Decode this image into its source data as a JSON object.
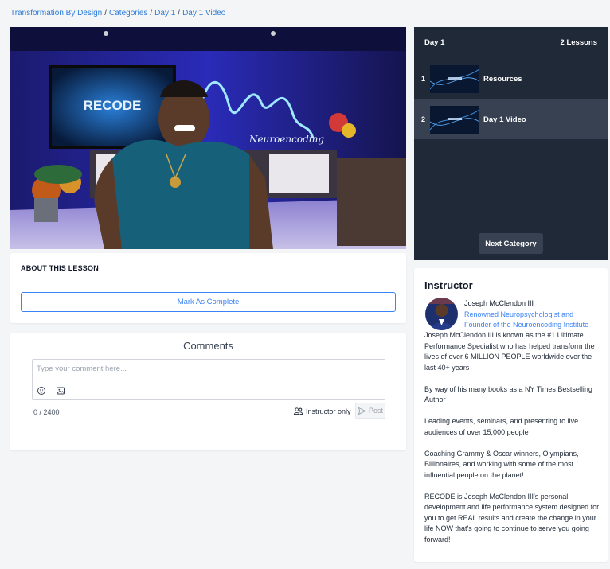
{
  "breadcrumb": {
    "items": [
      "Transformation By Design",
      "Categories",
      "Day 1",
      "Day 1 Video"
    ],
    "separator": "/"
  },
  "video": {
    "screen_text": "RECODE",
    "wall_text": "Neuroencoding"
  },
  "about": {
    "title": "ABOUT THIS LESSON",
    "mark_complete_label": "Mark As Complete"
  },
  "comments": {
    "title": "Comments",
    "placeholder": "Type your comment here...",
    "counter": "0 / 2400",
    "instructor_only_label": "Instructor only",
    "post_label": "Post",
    "icons": [
      "smiley-icon",
      "image-icon",
      "users-icon",
      "send-icon"
    ]
  },
  "playlist": {
    "category_title": "Day 1",
    "lesson_count": "2 Lessons",
    "items": [
      {
        "number": "1",
        "title": "Resources",
        "active": false
      },
      {
        "number": "2",
        "title": "Day 1 Video",
        "active": true
      }
    ],
    "next_category_label": "Next Category"
  },
  "instructor": {
    "heading": "Instructor",
    "name": "Joseph McClendon III",
    "role": "Renowned Neuropsychologist and Founder of the Neuroencoding Institute",
    "bio": [
      "Joseph McClendon III is known as the #1 Ultimate Performance Specialist who has helped transform the lives of over 6 MILLION PEOPLE worldwide over the last 40+ years",
      "By way of his many books as a NY Times Bestselling Author",
      "Leading events, seminars, and presenting to live audiences of over 15,000 people",
      "Coaching Grammy & Oscar winners, Olympians, Billionaires, and working with some of the most influential people on the planet!",
      "RECODE is Joseph McClendon III's personal development and life performance system designed for you to get REAL results and create the change in your life NOW that's going to continue to serve you going forward!"
    ]
  },
  "colors": {
    "link": "#2b7bd6",
    "accent": "#3b82f6",
    "playlist_bg": "#1f2937",
    "playlist_active": "#374151",
    "page_bg": "#f4f5f7"
  }
}
